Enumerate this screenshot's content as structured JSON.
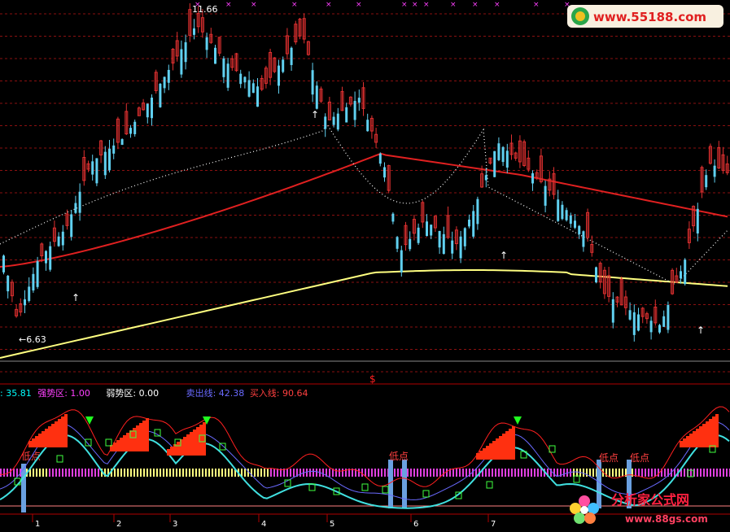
{
  "chart_data": [
    {
      "type": "candlestick",
      "annotations": {
        "high_label": "11.66",
        "low_label": "←6.63"
      },
      "high": 11.66,
      "low": 6.63,
      "moving_averages": [
        {
          "color": "#e02020",
          "style": "solid"
        },
        {
          "color": "#ffff80",
          "style": "solid"
        },
        {
          "color": "#ffffff",
          "style": "dotted"
        }
      ],
      "markers": {
        "up_arrow": "↑",
        "top_symbol": "×",
        "mid_symbol": "$"
      },
      "colors": {
        "up": "#e03030",
        "down": "#60d0f0",
        "grid": "#8a1010",
        "border": "#b00000"
      }
    },
    {
      "type": "indicator",
      "values": [
        {
          "label": ": 35.81",
          "color": "#00ffff"
        },
        {
          "label": "强势区: 1.00",
          "color": "#ff40ff"
        },
        {
          "label": "弱势区: 0.00",
          "color": "#ffffff"
        },
        {
          "label": "卖出线: 42.38",
          "color": "#6a6aff"
        },
        {
          "label": "买入线: 90.64",
          "color": "#ff4040"
        }
      ],
      "low_point_label": "低点",
      "x_ticks": [
        "1",
        "2",
        "3",
        "4",
        "5",
        "6",
        "7"
      ]
    }
  ],
  "branding": {
    "top_logo": "www.55188.com",
    "bottom_logo_cn": "分析家公式网",
    "bottom_logo_url": "www.88gs.com"
  }
}
